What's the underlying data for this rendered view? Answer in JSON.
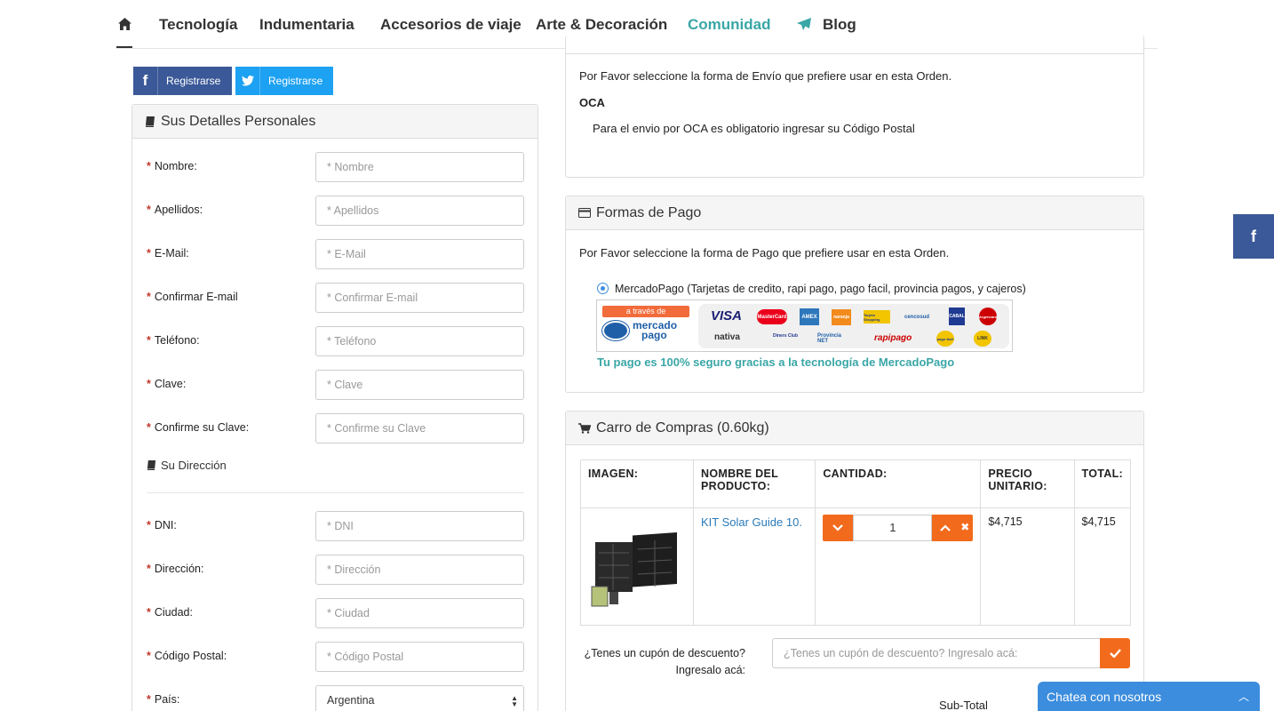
{
  "nav": {
    "items": [
      {
        "label": "Tecnología"
      },
      {
        "label": "Indumentaria"
      },
      {
        "label": "Accesorios de viaje"
      },
      {
        "label": "Arte & Decoración"
      },
      {
        "label": "Comunidad"
      },
      {
        "label": "Blog"
      }
    ],
    "active_color": "#3aa6a6"
  },
  "social": {
    "facebook_label": "Registrarse",
    "twitter_label": "Registrarse"
  },
  "personal": {
    "title": "Sus Detalles Personales",
    "fields": [
      {
        "label": "Nombre:",
        "placeholder": "* Nombre"
      },
      {
        "label": "Apellidos:",
        "placeholder": "* Apellidos"
      },
      {
        "label": "E-Mail:",
        "placeholder": "* E-Mail"
      },
      {
        "label": "Confirmar E-mail",
        "placeholder": "* Confirmar E-mail"
      },
      {
        "label": "Teléfono:",
        "placeholder": "* Teléfono"
      },
      {
        "label": "Clave:",
        "placeholder": "* Clave"
      },
      {
        "label": "Confirme su Clave:",
        "placeholder": "* Confirme su Clave"
      }
    ],
    "address_title": "Su Dirección",
    "address_fields": [
      {
        "label": "DNI:",
        "placeholder": "* DNI"
      },
      {
        "label": "Dirección:",
        "placeholder": "* Dirección"
      },
      {
        "label": "Ciudad:",
        "placeholder": "* Ciudad"
      },
      {
        "label": "Código Postal:",
        "placeholder": "* Código Postal"
      }
    ],
    "country": {
      "label": "País:",
      "value": "Argentina"
    },
    "required_mark": "*"
  },
  "shipping": {
    "intro": "Por Favor seleccione la forma de Envío que prefiere usar en esta Orden.",
    "method": "OCA",
    "note": "Para el envio por OCA es obligatorio ingresar su Código Postal"
  },
  "payment": {
    "title": "Formas de Pago",
    "intro": "Por Favor seleccione la forma de Pago que prefiere usar en esta Orden.",
    "option": "MercadoPago (Tarjetas de credito, rapi pago, pago facil, provincia pagos, y cajeros)",
    "banner_tag": "a través de",
    "banner_brand_1": "mercado",
    "banner_brand_2": "pago",
    "cards": [
      "VISA",
      "MasterCard",
      "AMEX",
      "naranja",
      "Tarjeta Shopping",
      "cencosud",
      "CABAL",
      "Argencard",
      "nativa",
      "Diners Club",
      "Provincia NET",
      "rapipago",
      "pago fácil",
      "LINK"
    ],
    "secure_text": "Tu pago es 100% seguro gracias a la tecnología de MercadoPago"
  },
  "cart": {
    "title": "Carro de Compras (0.60kg)",
    "headers": [
      "IMAGEN:",
      "NOMBRE DEL PRODUCTO:",
      "CANTIDAD:",
      "PRECIO UNITARIO:",
      "TOTAL:"
    ],
    "items": [
      {
        "name": "KIT Solar Guide 10.",
        "quantity": "1",
        "unit_price": "$4,715",
        "total": "$4,715"
      }
    ],
    "coupon_question": "¿Tenes un cupón de descuento? Ingresalo acá:",
    "coupon_placeholder": "¿Tenes un cupón de descuento? Ingresalo acá:",
    "subtotal_label": "Sub-Total"
  },
  "floating": {
    "facebook_icon_text": "f",
    "chat_label": "Chatea con nosotros"
  }
}
